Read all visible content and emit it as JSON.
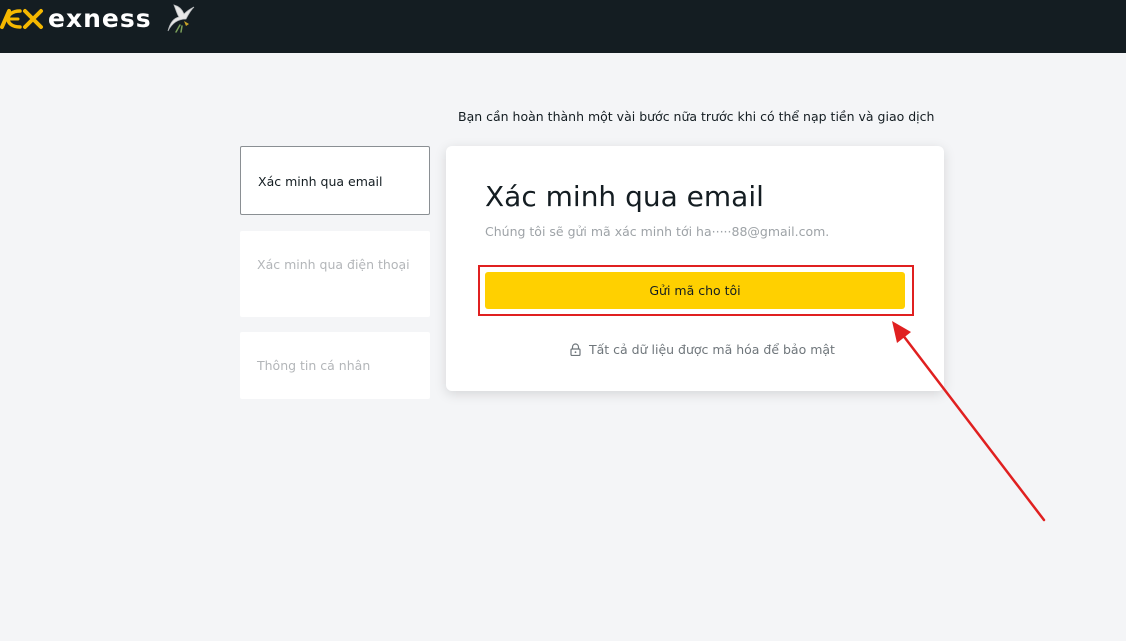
{
  "header": {
    "brand": "exness",
    "logo_icon": "exness-logo-icon",
    "mascot_icon": "dove-icon",
    "background": "#141d22",
    "logo_color": "#f5b800"
  },
  "notice": "Bạn cần hoàn thành một vài bước nữa trước khi có thể nạp tiền và giao dịch",
  "steps": [
    {
      "label": "Xác minh qua email",
      "state": "active"
    },
    {
      "label": "Xác minh qua điện thoại",
      "state": "inactive"
    },
    {
      "label": "Thông tin cá nhân",
      "state": "inactive"
    }
  ],
  "card": {
    "title": "Xác minh qua email",
    "subtitle": "Chúng tôi sẽ gửi mã xác minh tới ha·····88@gmail.com.",
    "button_label": "Gửi mã cho tôi",
    "button_color": "#ffd000",
    "security_note": "Tất cả dữ liệu được mã hóa để bảo mật",
    "security_icon": "lock-icon"
  },
  "annotation": {
    "highlight_color": "#e02020"
  }
}
